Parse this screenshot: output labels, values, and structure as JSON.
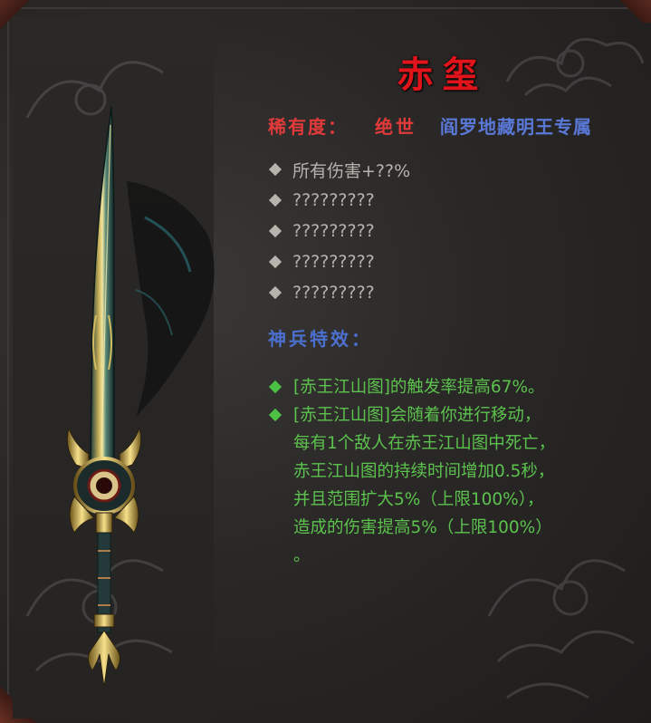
{
  "item": {
    "name": "赤玺",
    "rarity_label": "稀有度：",
    "rarity_value": "绝世",
    "exclusive": "阎罗地藏明王专属"
  },
  "stats": [
    "所有伤害+??%",
    "?????????",
    "?????????",
    "?????????",
    "?????????"
  ],
  "effect_title": "神兵特效：",
  "effects": [
    {
      "lines": [
        "[赤王江山图]的触发率提高67%。"
      ]
    },
    {
      "lines": [
        "[赤王江山图]会随着你进行移动，",
        "每有1个敌人在赤王江山图中死亡，",
        "赤王江山图的持续时间增加0.5秒，",
        "并且范围扩大5%（上限100%），",
        "造成的伤害提高5%（上限100%）",
        "。"
      ]
    }
  ],
  "colors": {
    "title": "#e0141a",
    "rarity": "#e23a3a",
    "exclusive": "#5a78d8",
    "stat_text": "#b6b2ad",
    "effect_title": "#4c70d0",
    "effect_text": "#5cc24e"
  },
  "icons": [
    "sword-icon",
    "cloud-pattern-icon",
    "diamond-bullet-icon"
  ]
}
